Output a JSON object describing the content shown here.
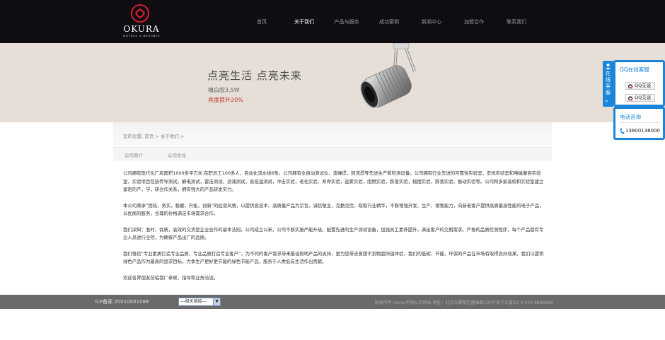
{
  "header": {
    "logo_text": "OKURA",
    "logo_sub": "HOTELS & RESORTS",
    "nav": [
      {
        "label": "首页"
      },
      {
        "label": "关于我们"
      },
      {
        "label": "产品与服务"
      },
      {
        "label": "成功案例"
      },
      {
        "label": "新闻中心"
      },
      {
        "label": "加盟合作"
      },
      {
        "label": "联系我们"
      }
    ],
    "active_index": 1
  },
  "banner": {
    "title": "点亮生活 点亮未来",
    "subtitle": "嗔白款3.5W",
    "highlight": "亮度提升20%"
  },
  "breadcrumb": {
    "prefix": "您的位置:",
    "home": "首页",
    "sep": ">",
    "current": "关于我们",
    "trail_sep": ">"
  },
  "subtabs": [
    {
      "label": "公司简介"
    },
    {
      "label": "公司文化"
    }
  ],
  "content": {
    "paragraphs": [
      "公司拥有现代化厂房面积1000多平方米,在职员工100多人，自动化流水线6条。公司拥有全自动测试仪，波峰焊，回流焊等先进生产和检测设备。公司拥有行业先进的可靠性实验室，安规实验室和电磁兼容实验室，实验项目包括传导测试，静电测试，雷击测试，浪涌测试，高低温测试，冲击实验，老化实验，寿命实验，盐雾实验，阻燃实验，跌落实验，摇摆实验，跌落实验，振动实验等。公司和多家高校和实验室建立紧密的产，学，研合作关系，拥有强大的产品研发实力。",
      "本公司秉承“团结，务实，稳健，开拓，创新”的经营风格，以提供高技术、高质量产品为宗旨，诚信敬业，克勤克俭，取取行业精华，不断增强开发、生产、销售能力，向新老客户提供高质量高性能的电子产品，以优质的服务，合理的价格满足市场需求合作。",
      "我们深知：准时、保质，高效的交货是企业合作的基本法则，公司成立以来，公司不断实施严能升级，配置先进的生产测试设备，加强员工素养提升，满足客户的交期需求。严格的品质检测程序，每个产品都有专业人员进行全检，为确保产品出厂的品质。",
      "我们恪信“专业素质打造专业品质，专业品质打造专业客户”，为不同的客户需求带来最佳照明产品的支持，更为您带去意想不到物超所值体验，我们的低碳、节能、环保的产品在市场有取得良好效果，我们以提供绿色产品作为最高的追求目标，力争生产更好更节能的绿色节能产品，服务于人类低炭生活作出贡献。",
      "欢迎各界朋友莅临我厂参观、指导和业务洽谈。"
    ]
  },
  "footer": {
    "icp": "ICP备案 20010001088",
    "links_select": "---相关链接---",
    "copyright": "版权所有 xxxxx有限公司网站 地址：北京市朝阳区建国路100号双子大厦D3-4 010-8888888"
  },
  "service": {
    "tab_text": "在线客服",
    "qq_title": "QQ在线客服",
    "qq_buttons": [
      {
        "label": "QQ交谈"
      },
      {
        "label": "QQ交谈"
      }
    ],
    "tel_title": "电话咨询",
    "tel_number": "13800138000"
  },
  "colors": {
    "header_bg": "#0f0d12",
    "banner_bg": "#e6dfd7",
    "accent_red": "#c0392b",
    "service_blue": "#1b86d9",
    "footer_bg": "#6a6a6a"
  }
}
